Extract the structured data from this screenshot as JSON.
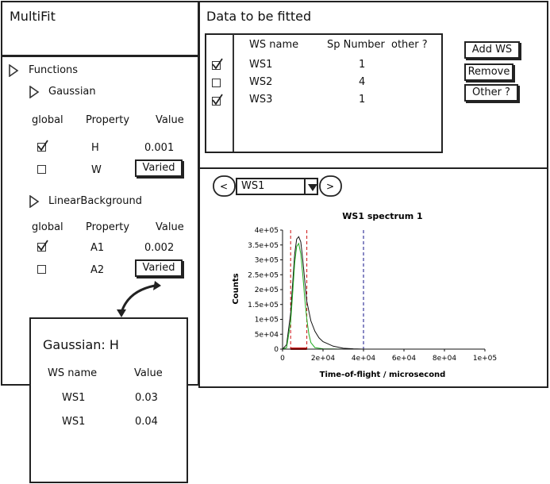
{
  "app": {
    "title": "MultiFit"
  },
  "functions": {
    "header": "Functions",
    "gaussian": {
      "name": "Gaussian",
      "col_global": "global",
      "col_property": "Property",
      "col_value": "Value",
      "rows": [
        {
          "property": "H",
          "value": "0.001",
          "global": true
        },
        {
          "property": "W",
          "value": "Varied",
          "global": false
        }
      ]
    },
    "linear": {
      "name": "LinearBackground",
      "col_global": "global",
      "col_property": "Property",
      "col_value": "Value",
      "rows": [
        {
          "property": "A1",
          "value": "0.002",
          "global": true
        },
        {
          "property": "A2",
          "value": "Varied",
          "global": false
        }
      ]
    }
  },
  "data": {
    "title": "Data to be fitted",
    "col_ws": "WS name",
    "col_sp": "Sp Number",
    "col_other": "other ?",
    "rows": [
      {
        "ws": "WS1",
        "sp": "1",
        "checked": true
      },
      {
        "ws": "WS2",
        "sp": "4",
        "checked": false
      },
      {
        "ws": "WS3",
        "sp": "1",
        "checked": true
      }
    ],
    "buttons": {
      "add": "Add WS",
      "remove": "Remove",
      "other": "Other ?"
    }
  },
  "nav": {
    "selected": "WS1",
    "prev": "<",
    "next": ">"
  },
  "popup": {
    "title": "Gaussian: H",
    "col_ws": "WS name",
    "col_value": "Value",
    "rows": [
      {
        "ws": "WS1",
        "value": "0.03"
      },
      {
        "ws": "WS1",
        "value": "0.04"
      }
    ]
  },
  "chart_data": {
    "type": "line",
    "title": "WS1 spectrum 1",
    "xlabel": "Time-of-flight / microsecond",
    "ylabel": "Counts",
    "xlim": [
      0,
      100000
    ],
    "ylim": [
      0,
      400000
    ],
    "xticks": [
      "0",
      "2e+04",
      "4e+04",
      "6e+04",
      "8e+04",
      "1e+05"
    ],
    "yticks": [
      "0",
      "5e+04",
      "1e+05",
      "1.5e+05",
      "2e+05",
      "2.5e+05",
      "3e+05",
      "3.5e+05",
      "4e+05"
    ],
    "series": [
      {
        "color": "#111111",
        "x": [
          0,
          2000,
          4000,
          6000,
          7000,
          8000,
          9000,
          10000,
          11000,
          12000,
          14000,
          16000,
          18000,
          20000,
          25000,
          30000,
          35000,
          40000,
          100000
        ],
        "y": [
          0,
          15000,
          120000,
          320000,
          370000,
          378000,
          360000,
          300000,
          230000,
          160000,
          95000,
          60000,
          38000,
          25000,
          10000,
          3000,
          1000,
          0,
          0
        ]
      },
      {
        "color": "#1faa1f",
        "x": [
          0,
          2000,
          4000,
          5000,
          6000,
          7000,
          8000,
          9000,
          10000,
          11000,
          12000,
          13000,
          14000,
          16000,
          20000,
          30000,
          40000,
          100000
        ],
        "y": [
          0,
          5000,
          90000,
          190000,
          290000,
          345000,
          355000,
          320000,
          250000,
          170000,
          100000,
          50000,
          22000,
          5000,
          1000,
          0,
          0,
          0
        ]
      }
    ],
    "markers": [
      {
        "x": 4000,
        "color": "#cc1111"
      },
      {
        "x": 12000,
        "color": "#cc1111"
      },
      {
        "x": 40000,
        "color": "#111188"
      }
    ],
    "fill": {
      "x0": 4000,
      "x1": 12000,
      "color": "#cc1111"
    }
  }
}
